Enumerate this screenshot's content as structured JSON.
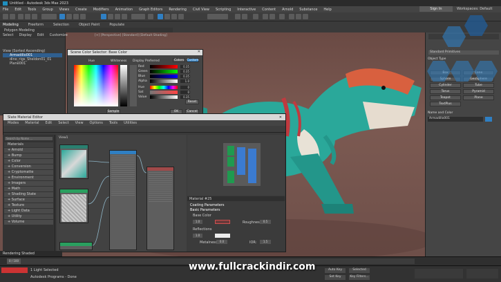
{
  "app": {
    "title": "Untitled - Autodesk 3ds Max 2023",
    "sign_in": "Sign In",
    "workspace": "Workspaces: Default"
  },
  "menu": [
    "File",
    "Edit",
    "Tools",
    "Group",
    "Views",
    "Create",
    "Modifiers",
    "Animation",
    "Graph Editors",
    "Rendering",
    "Civil View",
    "Scripting",
    "Interactive",
    "Content",
    "Arnold",
    "Substance",
    "Help"
  ],
  "ribbon": {
    "tabs": [
      "Modeling",
      "Freeform",
      "Selection",
      "Object Paint",
      "Populate"
    ],
    "sub": "Polygon Modeling"
  },
  "scene_explorer": {
    "tabs": [
      "Select",
      "Display",
      "Edit",
      "Customize"
    ],
    "items": [
      "View (Sorted Ascending)",
      "Armadillo001",
      "dino_rigs_Sheldon01_01",
      "Plane001"
    ]
  },
  "viewport": {
    "label": "[+] [Perspective] [Standard] [Default Shading]"
  },
  "color_selector": {
    "title": "Scene Color Selector: Base Color",
    "hue_label": "Hue",
    "whiteness_label": "Whiteness",
    "display_label": "Display Preferred",
    "tabs": [
      "Colors",
      "Custom"
    ],
    "channels": [
      {
        "name": "Red",
        "value": "0.35"
      },
      {
        "name": "Green",
        "value": "0.35"
      },
      {
        "name": "Blue",
        "value": "0.35"
      },
      {
        "name": "Alpha",
        "value": "1.0"
      },
      {
        "name": "Hue",
        "value": "0"
      },
      {
        "name": "Sat",
        "value": "0"
      },
      {
        "name": "Value",
        "value": "0.35"
      }
    ],
    "buttons": {
      "sample": "Sample",
      "reset": "Reset",
      "ok": "OK",
      "cancel": "Cancel"
    }
  },
  "material_editor": {
    "title": "Slate Material Editor",
    "menu": [
      "Modes",
      "Material",
      "Edit",
      "Select",
      "View",
      "Options",
      "Tools",
      "Utilities"
    ],
    "browser_search": "Search by Name ...",
    "browser_sections": [
      "Materials",
      "+ Arnold",
      "+ Bump",
      "+ Color",
      "+ Conversion",
      "+ Cryptomatte",
      "+ Environment",
      "+ Imagers",
      "+ Math",
      "+ Shading State",
      "+ Surface",
      "+ Texture",
      "+ Light Data",
      "+ Utility",
      "+ Volume"
    ],
    "view_tab": "View1",
    "params_header": "Material #25",
    "coating": "Coating Parameters",
    "basic": "Basic Parameters",
    "base_color": "Base Color",
    "roughness": "Roughness:",
    "reflections": "Reflections",
    "metalness": "Metalness:",
    "ior": "IOR:",
    "roughness_value": "0.5",
    "metal_value": "0.0",
    "ior_value": "1.5",
    "weight": "1.0"
  },
  "command_panel": {
    "title": "Standard Primitives",
    "section_types": "Object Type",
    "buttons": [
      "Box",
      "Cone",
      "Sphere",
      "GeoSphere",
      "Cylinder",
      "Tube",
      "Torus",
      "Pyramid",
      "Teapot",
      "Plane",
      "TextPlus"
    ],
    "section_name": "Name and Color",
    "name_value": "Armadillo001"
  },
  "bottom": {
    "rendering": "Rendering Shaded",
    "status": "1 Light Selected",
    "prompt": "Autodesk Programs - Done",
    "frame": "0 / 100",
    "auto_key": "Auto Key",
    "selected": "Selected",
    "set_key": "Set Key",
    "key_filters": "Key Filters..."
  },
  "watermark": "www.fullcrackindir.com",
  "colors": {
    "accent": "#2f7fc3",
    "viewport_bg": "#7c5a52",
    "dino": "#2aa89a"
  }
}
